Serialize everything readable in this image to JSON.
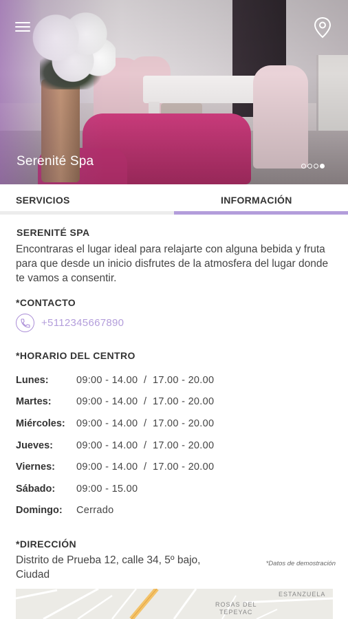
{
  "hero": {
    "title": "Serenité Spa",
    "slides": 4,
    "active_slide": 4
  },
  "icons": {
    "menu": "hamburger-menu-icon",
    "location": "map-pin-icon",
    "phone": "phone-icon"
  },
  "colors": {
    "accent": "#b39ddb",
    "text": "#333333"
  },
  "tabs": [
    {
      "label": "SERVICIOS",
      "active": false
    },
    {
      "label": "INFORMACIÓN",
      "active": true
    }
  ],
  "info": {
    "name": "SERENITÉ SPA",
    "description": "Encontraras el lugar ideal para relajarte con alguna bebida y fruta para que desde un inicio disfrutes de la atmosfera del lugar donde te vamos a consentir.",
    "contact_title": "*CONTACTO",
    "phone": "+5112345667890",
    "hours_title": "*HORARIO DEL CENTRO",
    "hours": [
      {
        "day": "Lunes:",
        "time": "09:00 - 14.00  /  17.00 - 20.00"
      },
      {
        "day": "Martes:",
        "time": "09:00 - 14.00  /  17.00 - 20.00"
      },
      {
        "day": "Miércoles:",
        "time": "09:00 - 14.00  /  17.00 - 20.00"
      },
      {
        "day": "Jueves:",
        "time": "09:00 - 14.00  /  17.00 - 20.00"
      },
      {
        "day": "Viernes:",
        "time": "09:00 - 14.00  /  17.00 - 20.00"
      },
      {
        "day": "Sábado:",
        "time": "09:00 - 15.00"
      },
      {
        "day": "Domingo:",
        "time": "Cerrado"
      }
    ],
    "address_title": "*DIRECCIÓN",
    "address_line1": "Distrito de Prueba 12, calle 34, 5º bajo,",
    "address_line2": "Ciudad",
    "demo_note": "*Datos de demostración"
  },
  "map": {
    "labels": [
      "ROSAS DEL",
      "TEPEYAC",
      "ESTANZUELA"
    ]
  }
}
